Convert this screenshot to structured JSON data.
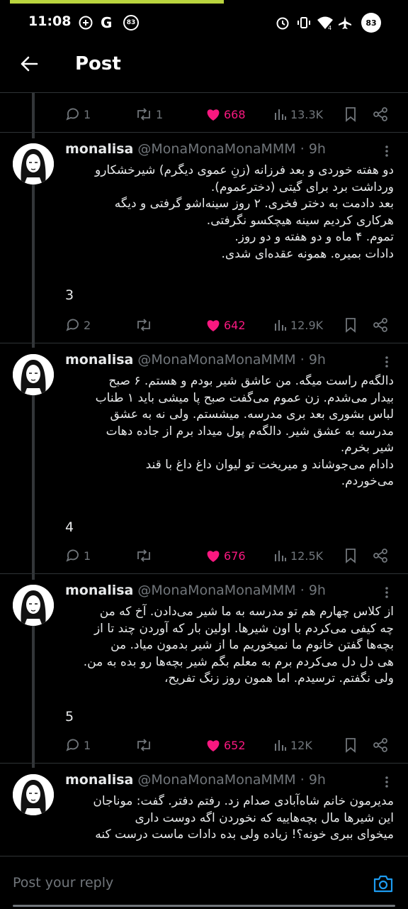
{
  "status_bar": {
    "time": "11:08",
    "badge": "83",
    "signal_label": "4",
    "battery": "83"
  },
  "header": {
    "title": "Post"
  },
  "colors": {
    "like": "#f91880",
    "accent": "#1d9bf0",
    "muted": "#71767b"
  },
  "top_actions": {
    "replies": "1",
    "reposts": "1",
    "likes": "668",
    "views": "13.3K"
  },
  "tweets": [
    {
      "name": "monalisa",
      "handle": "@MonaMonaMonaMMM",
      "dot": "·",
      "time": "9h",
      "lines": [
        "دو هفته خوردی و بعد فرزانه (زنِ عموی دیگرم) شیرخشکارو",
        "ورداشت برد برای گیتی (دخترعموم).",
        "بعد دادمت به دختر فخری. ۲ روز سینه‌اشو گرفتی و دیگه",
        "هرکاری کردیم سینه هیچکسو نگرفتی.",
        "تموم. ۴ ماه و دو هفته و دو روز.",
        "دادات بمیره. همونه عقده‌ای شدی."
      ],
      "number": "3",
      "replies": "2",
      "reposts": "",
      "likes": "642",
      "views": "12.9K"
    },
    {
      "name": "monalisa",
      "handle": "@MonaMonaMonaMMM",
      "dot": "·",
      "time": "9h",
      "lines": [
        "دالگه‌م راست میگه. من عاشق شیر بودم و هستم. ۶ صبح",
        "بیدار می‌شدم. زن عموم می‌گفت صبح پا میشی باید ۱ طناب",
        "لباس بشوری بعد بری مدرسه. میشستم. ولی نه به عشق",
        "مدرسه به عشق شیر. دالگه‌م پول میداد برم از جاده دهات",
        "شیر بخرم.",
        "دادام می‌جوشاند و میریخت تو لیوان داغ داغ با قند",
        "می‌خوردم."
      ],
      "number": "4",
      "replies": "1",
      "reposts": "",
      "likes": "676",
      "views": "12.5K"
    },
    {
      "name": "monalisa",
      "handle": "@MonaMonaMonaMMM",
      "dot": "·",
      "time": "9h",
      "lines": [
        "از کلاس چهارم هم تو مدرسه به ما شیر می‌دادن. آخ که من",
        "چه کیفی می‌کردم با اون شیرها. اولین بار که آوردن چند تا از",
        "بچه‌ها گفتن خانوم ما نمیخوریم ما از شیر بدمون میاد. من",
        "هی دل دل می‌کردم برم به معلم بگم شیر بچه‌ها رو بده به من.",
        "ولی نگفتم. ترسیدم. اما همون روز زنگ تفریح،"
      ],
      "number": "5",
      "replies": "1",
      "reposts": "",
      "likes": "652",
      "views": "12K"
    },
    {
      "name": "monalisa",
      "handle": "@MonaMonaMonaMMM",
      "dot": "·",
      "time": "9h",
      "lines": [
        "مدیرمون خانم شاه‌آبادی صدام زد. رفتم دفتر. گفت: موناجان",
        "این شیرها مال بچه‌هاییه که نخوردن اگه دوست داری",
        "میخوای ببری خونه؟! زیاده ولی بده دادات ماست درست کنه"
      ]
    }
  ],
  "reply_bar": {
    "placeholder": "Post your reply"
  }
}
